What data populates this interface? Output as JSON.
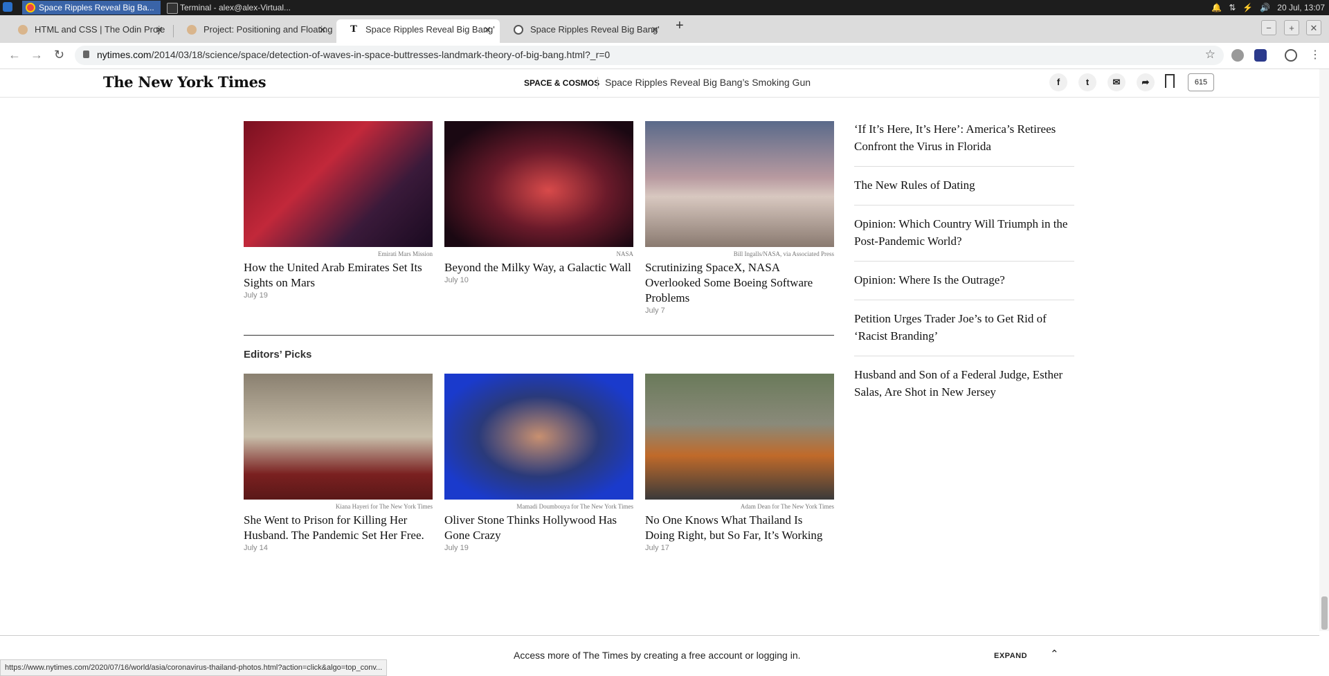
{
  "os": {
    "tasks": [
      "Space Ripples Reveal Big Ba...",
      "Terminal - alex@alex-Virtual..."
    ],
    "clock": "20 Jul, 13:07"
  },
  "browser": {
    "tabs": [
      {
        "label": "HTML and CSS | The Odin Proje"
      },
      {
        "label": "Project: Positioning and Floating"
      },
      {
        "label": "Space Ripples Reveal Big Bang'"
      },
      {
        "label": "Space Ripples Reveal Big Bang'"
      }
    ],
    "url_domain": "nytimes.com",
    "url_path": "/2014/03/18/science/space/detection-of-waves-in-space-buttresses-landmark-theory-of-big-bang.html?_r=0"
  },
  "nyt_header": {
    "logo": "The New York Times",
    "section": "SPACE & COSMOS",
    "headline": "Space Ripples Reveal Big Bang’s Smoking Gun",
    "comment_count": "615"
  },
  "space_cards": [
    {
      "credit": "Emirati Mars Mission",
      "title": "How the United Arab Emirates Set Its Sights on Mars",
      "date": "July 19"
    },
    {
      "credit": "NASA",
      "title": "Beyond the Milky Way, a Galactic Wall",
      "date": "July 10"
    },
    {
      "credit": "Bill Ingalls/NASA, via Associated Press",
      "title": "Scrutinizing SpaceX, NASA Overlooked Some Boeing Software Problems",
      "date": "July 7"
    }
  ],
  "editors_picks": {
    "heading": "Editors’ Picks",
    "cards": [
      {
        "credit": "Kiana Hayeri for The New York Times",
        "title": "She Went to Prison for Killing Her Husband. The Pandemic Set Her Free.",
        "date": "July 14"
      },
      {
        "credit": "Mamadi Doumbouya for The New York Times",
        "title": "Oliver Stone Thinks Hollywood Has Gone Crazy",
        "date": "July 19"
      },
      {
        "credit": "Adam Dean for The New York Times",
        "title": "No One Knows What Thailand Is Doing Right, but So Far, It’s Working",
        "date": "July 17"
      }
    ]
  },
  "sidebar": [
    "‘If It’s Here, It’s Here’: America’s Retirees Confront the Virus in Florida",
    "The New Rules of Dating",
    "Opinion: Which Country Will Triumph in the Post-Pandemic World?",
    "Opinion: Where Is the Outrage?",
    "Petition Urges Trader Joe’s to Get Rid of ‘Racist Branding’",
    "Husband and Son of a Federal Judge, Esther Salas, Are Shot in New Jersey"
  ],
  "bottom_bar": {
    "text": "Access more of The Times by creating a free account or logging in.",
    "expand": "EXPAND"
  },
  "status_url": "https://www.nytimes.com/2020/07/16/world/asia/coronavirus-thailand-photos.html?action=click&algo=top_conv..."
}
